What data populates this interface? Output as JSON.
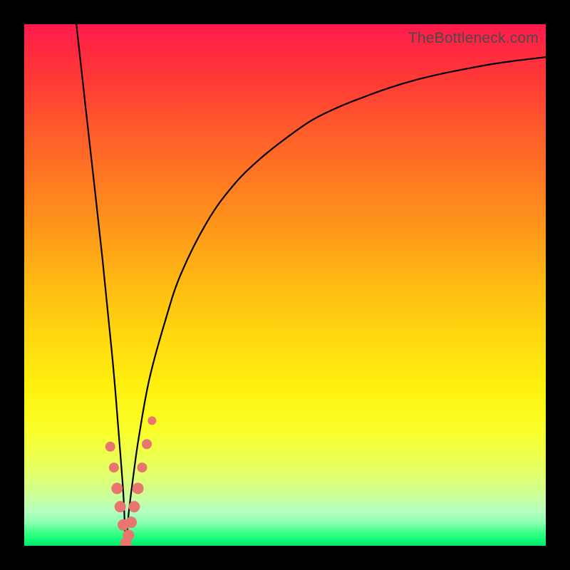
{
  "watermark": "TheBottleneck.com",
  "colors": {
    "frame": "#000000",
    "curve": "#000000",
    "marker": "#e8766f",
    "gradient_top": "#ff1a4d",
    "gradient_bottom": "#00e86b"
  },
  "chart_data": {
    "type": "line",
    "title": "",
    "xlabel": "",
    "ylabel": "",
    "xlim": [
      0,
      100
    ],
    "ylim": [
      0,
      100
    ],
    "x_min_curve": 19.5,
    "series": [
      {
        "name": "bottleneck-curve",
        "x": [
          10,
          12,
          15,
          17,
          18,
          19,
          19.5,
          20,
          21,
          22,
          24,
          27,
          30,
          35,
          40,
          45,
          50,
          55,
          60,
          65,
          70,
          75,
          80,
          85,
          90,
          95,
          100
        ],
        "y": [
          100,
          82,
          55,
          35,
          23,
          10,
          0,
          6,
          14,
          21,
          32,
          43,
          52,
          62,
          69,
          74,
          78,
          81.5,
          84,
          86,
          87.8,
          89.3,
          90.5,
          91.5,
          92.4,
          93.1,
          93.7
        ]
      }
    ],
    "markers": {
      "name": "highlighted-points",
      "x": [
        16.5,
        17.2,
        17.8,
        18.4,
        19.0,
        19.5,
        20.0,
        20.5,
        21.1,
        21.8,
        22.6,
        23.5,
        24.5
      ],
      "y": [
        19.0,
        15.0,
        11.0,
        7.5,
        4.0,
        0.5,
        2.0,
        4.5,
        7.5,
        11.0,
        15.0,
        19.5,
        24.0
      ],
      "r": [
        7,
        7,
        8,
        8,
        8,
        8,
        8,
        8,
        8,
        8,
        7,
        7,
        6
      ]
    }
  }
}
